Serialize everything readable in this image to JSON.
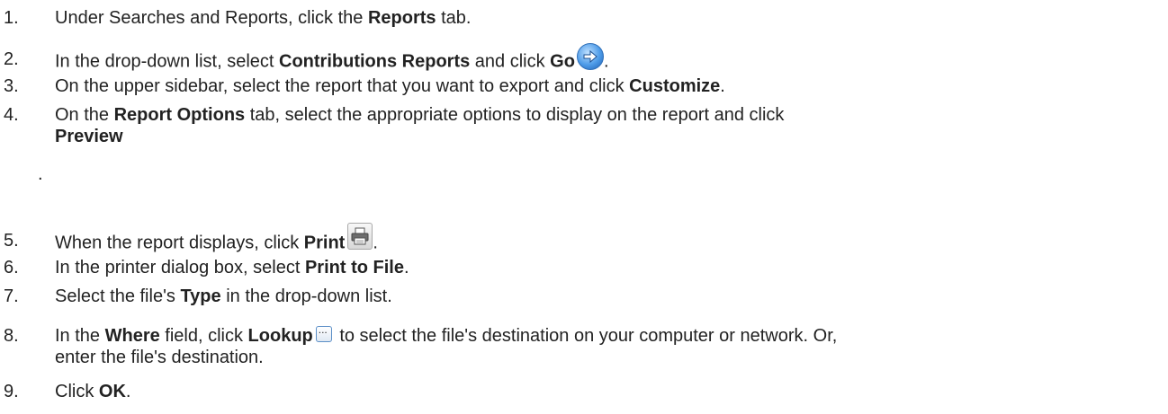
{
  "steps": [
    {
      "num": "1.",
      "pre": "Under Searches and Reports, click the ",
      "b1": "Reports",
      "post": " tab."
    },
    {
      "num": "2.",
      "pre": "In the drop-down list, select ",
      "b1": "Contributions Reports",
      "mid": " and click ",
      "b2": "Go",
      "post": ".",
      "icon": "go-arrow-icon"
    },
    {
      "num": "3.",
      "pre": "On the upper sidebar, select the report that you want to export and click ",
      "b1": "Customize",
      "post": "."
    },
    {
      "num": "4.",
      "pre": "On the ",
      "b1": "Report Options",
      "mid": " tab, select the appropriate options to display on the report and click",
      "b2": "Preview",
      "stray": "."
    },
    {
      "num": "5.",
      "pre": "When the report displays, click ",
      "b1": "Print",
      "post": ".",
      "icon": "printer-icon"
    },
    {
      "num": "6.",
      "pre": "In the printer dialog box, select ",
      "b1": "Print to File",
      "post": "."
    },
    {
      "num": "7.",
      "pre": "Select the file's ",
      "b1": "Type",
      "post": " in the drop-down list."
    },
    {
      "num": "8.",
      "pre": "In the ",
      "b1": "Where",
      "mid": " field, click ",
      "b2": "Lookup",
      "post": " to select the file's destination on your computer or network. Or,",
      "line2": "enter the file's destination.",
      "icon": "lookup-ellipsis-icon",
      "icon_text": "..."
    },
    {
      "num": "9.",
      "pre": "Click ",
      "b1": "OK",
      "post": "."
    }
  ]
}
